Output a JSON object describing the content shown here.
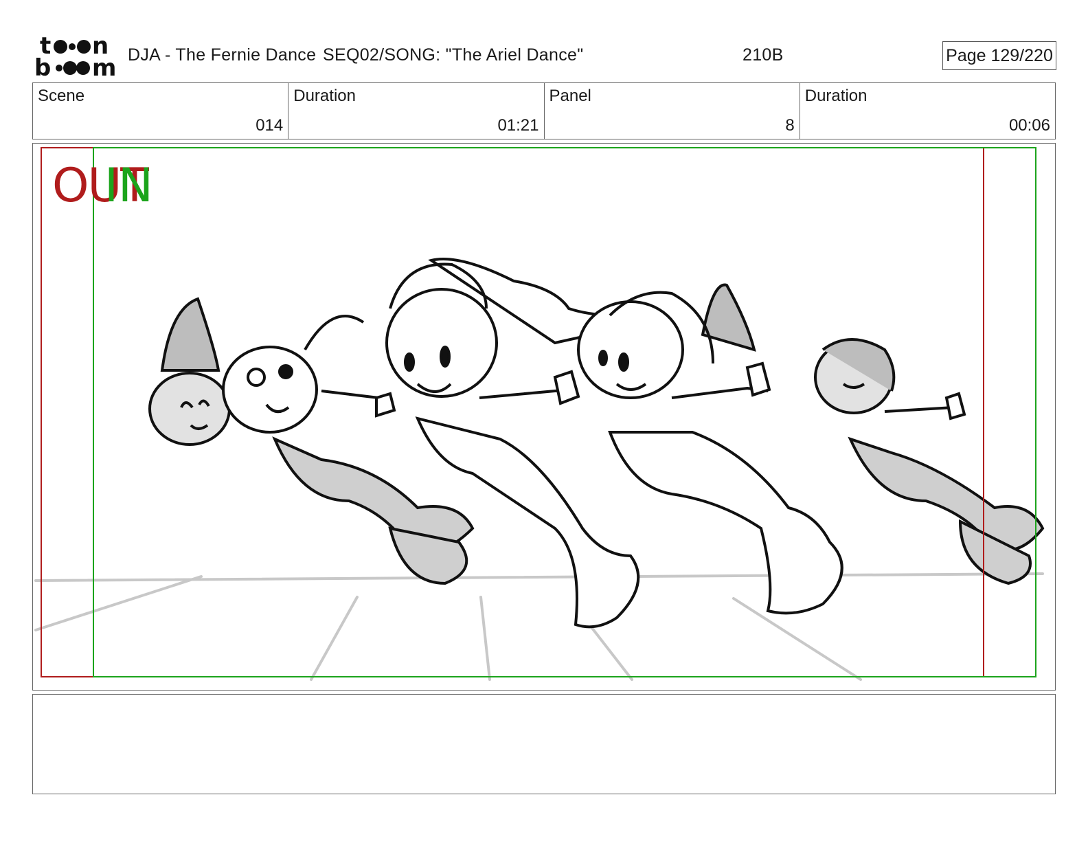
{
  "header": {
    "logo_text": "toon boom",
    "project": "DJA - The Fernie Dance",
    "sequence": "SEQ02/SONG: \"The Ariel Dance\"",
    "code": "210B",
    "page": "Page 129/220"
  },
  "info": {
    "scene_label": "Scene",
    "scene_value": "014",
    "scene_duration_label": "Duration",
    "scene_duration_value": "01:21",
    "panel_label": "Panel",
    "panel_value": "8",
    "panel_duration_label": "Duration",
    "panel_duration_value": "00:06"
  },
  "panel": {
    "out_label": "OUT",
    "in_label": "IN",
    "out_frame_color": "#b01c1c",
    "in_frame_color": "#1ca41c"
  },
  "notes": {
    "text": ""
  }
}
